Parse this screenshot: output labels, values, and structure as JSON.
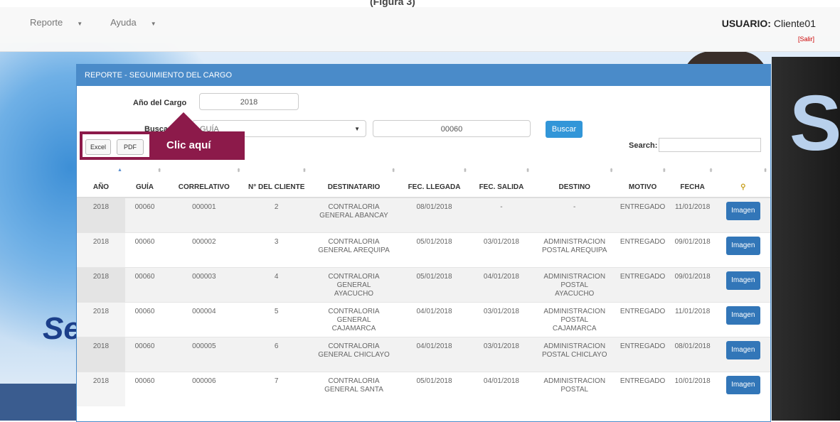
{
  "header": {
    "top_title": "(Figura 3)",
    "menu": [
      "Reporte",
      "Ayuda"
    ],
    "user_label": "USUARIO:",
    "user_name": "Cliente01",
    "logout": "[Salir]"
  },
  "panel": {
    "title": "REPORTE - SEGUIMIENTO DEL CARGO",
    "year_label": "Año del Cargo",
    "year_value": "2018",
    "search_by_label": "Buscar P",
    "search_by_value": "GUÍA",
    "guide_value": "00060",
    "search_button": "Buscar",
    "excel_button": "Excel",
    "pdf_button": "PDF",
    "search_label": "Search:",
    "callout": "Clic aquí"
  },
  "table": {
    "headers": [
      "AÑO",
      "GUÍA",
      "CORRELATIVO",
      "N° DEL CLIENTE",
      "DESTINATARIO",
      "FEC. LLEGADA",
      "FEC. SALIDA",
      "DESTINO",
      "MOTIVO",
      "FECHA",
      ""
    ],
    "rows": [
      [
        "2018",
        "00060",
        "000001",
        "2",
        "CONTRALORIA GENERAL ABANCAY",
        "08/01/2018",
        "-",
        "-",
        "ENTREGADO",
        "11/01/2018",
        "Imagen"
      ],
      [
        "2018",
        "00060",
        "000002",
        "3",
        "CONTRALORIA GENERAL AREQUIPA",
        "05/01/2018",
        "03/01/2018",
        "ADMINISTRACION POSTAL AREQUIPA",
        "ENTREGADO",
        "09/01/2018",
        "Imagen"
      ],
      [
        "2018",
        "00060",
        "000003",
        "4",
        "CONTRALORIA GENERAL AYACUCHO",
        "05/01/2018",
        "04/01/2018",
        "ADMINISTRACION POSTAL AYACUCHO",
        "ENTREGADO",
        "09/01/2018",
        "Imagen"
      ],
      [
        "2018",
        "00060",
        "000004",
        "5",
        "CONTRALORIA GENERAL CAJAMARCA",
        "04/01/2018",
        "03/01/2018",
        "ADMINISTRACION POSTAL CAJAMARCA",
        "ENTREGADO",
        "11/01/2018",
        "Imagen"
      ],
      [
        "2018",
        "00060",
        "000005",
        "6",
        "CONTRALORIA GENERAL CHICLAYO",
        "04/01/2018",
        "03/01/2018",
        "ADMINISTRACION POSTAL CHICLAYO",
        "ENTREGADO",
        "08/01/2018",
        "Imagen"
      ],
      [
        "2018",
        "00060",
        "000006",
        "7",
        "CONTRALORIA GENERAL SANTA",
        "05/01/2018",
        "04/01/2018",
        "ADMINISTRACION POSTAL",
        "ENTREGADO",
        "10/01/2018",
        "Imagen"
      ]
    ]
  },
  "background": {
    "logo_text": "Se",
    "decor_letter": "S"
  }
}
